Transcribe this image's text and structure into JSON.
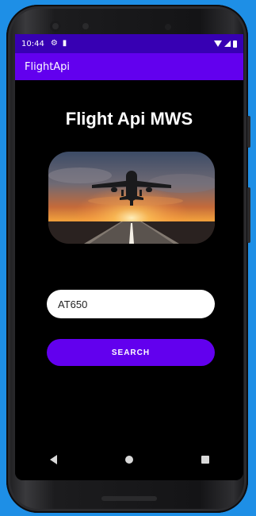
{
  "status_bar": {
    "time": "10:44",
    "icons": [
      "gear-icon",
      "sim-icon",
      "wifi-icon",
      "signal-icon",
      "battery-icon"
    ]
  },
  "app_bar": {
    "title": "FlightApi"
  },
  "main": {
    "heading": "Flight Api MWS",
    "hero_image": "airplane-takeoff-sunset",
    "flight_input": {
      "value": "AT650",
      "placeholder": ""
    },
    "search_button": {
      "label": "SEARCH"
    }
  },
  "nav_bar": {
    "items": [
      "back-icon",
      "home-icon",
      "recents-icon"
    ]
  },
  "colors": {
    "primary": "#6200ee",
    "primary_dark": "#3700b3",
    "background": "#000000",
    "desktop": "#1e8fe6"
  }
}
